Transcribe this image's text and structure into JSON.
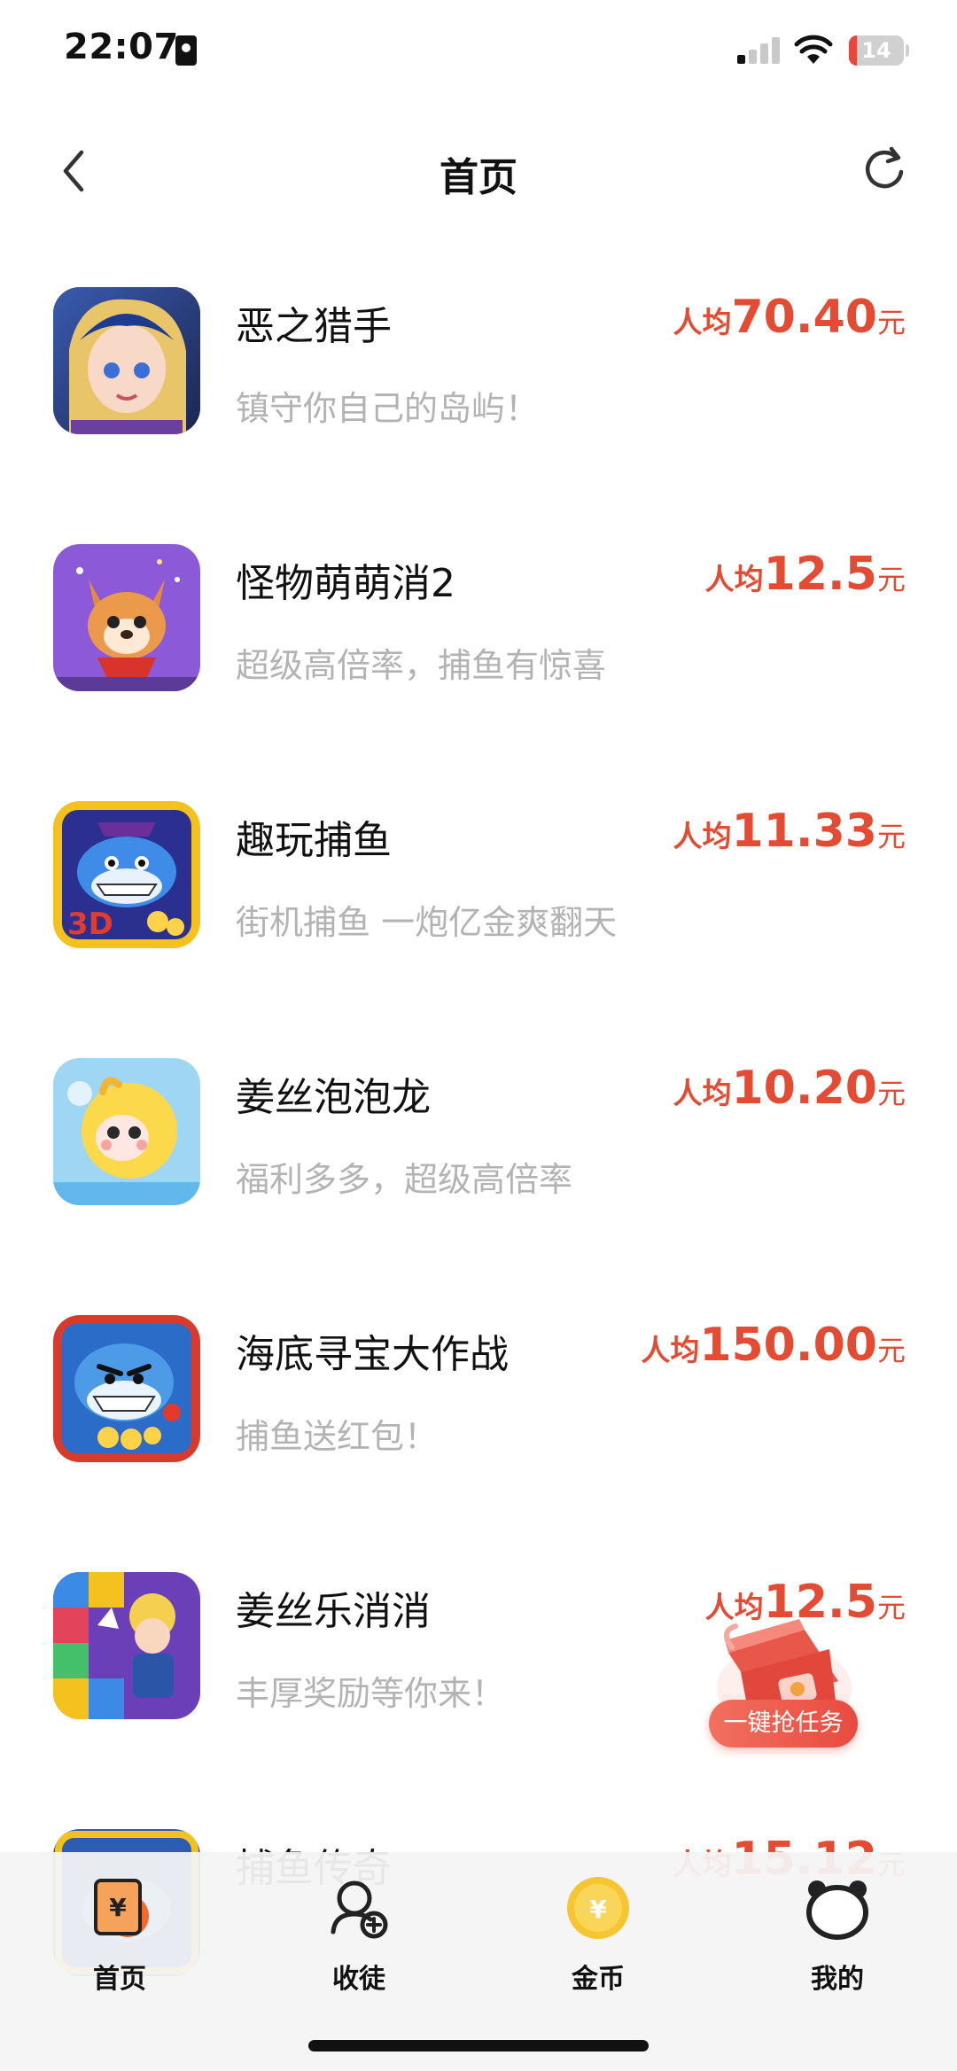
{
  "status_bar": {
    "time": "22:07",
    "battery_level": "14",
    "battery_fraction": 0.14
  },
  "nav": {
    "title": "首页"
  },
  "games": [
    {
      "name": "恶之猎手",
      "description": "镇守你自己的岛屿！",
      "reward_prefix": "人均",
      "reward_amount": "70.40",
      "reward_unit": "元",
      "icon": "hunter-game-icon"
    },
    {
      "name": "怪物萌萌消2",
      "description": "超级高倍率，捕鱼有惊喜",
      "reward_prefix": "人均",
      "reward_amount": "12.5",
      "reward_unit": "元",
      "icon": "corgi-game-icon"
    },
    {
      "name": "趣玩捕鱼",
      "description": "街机捕鱼 一炮亿金爽翻天",
      "reward_prefix": "人均",
      "reward_amount": "11.33",
      "reward_unit": "元",
      "icon": "shark-3d-game-icon"
    },
    {
      "name": "姜丝泡泡龙",
      "description": "福利多多，超级高倍率",
      "reward_prefix": "人均",
      "reward_amount": "10.20",
      "reward_unit": "元",
      "icon": "bubble-game-icon"
    },
    {
      "name": "海底寻宝大作战",
      "description": "捕鱼送红包！",
      "reward_prefix": "人均",
      "reward_amount": "150.00",
      "reward_unit": "元",
      "icon": "angry-shark-game-icon"
    },
    {
      "name": "姜丝乐消消",
      "description": "丰厚奖励等你来！",
      "reward_prefix": "人均",
      "reward_amount": "12.5",
      "reward_unit": "元",
      "icon": "puzzle-game-icon"
    },
    {
      "name": "捕鱼传奇",
      "description": "",
      "reward_prefix": "人均",
      "reward_amount": "15.12",
      "reward_unit": "元",
      "icon": "fishing-game-icon"
    }
  ],
  "task_float": {
    "label": "一键抢任务"
  },
  "tabs": [
    {
      "label": "首页",
      "icon": "home-tab-icon"
    },
    {
      "label": "收徒",
      "icon": "recruit-tab-icon"
    },
    {
      "label": "金币",
      "icon": "coin-tab-icon"
    },
    {
      "label": "我的",
      "icon": "bear-profile-tab-icon"
    }
  ],
  "colors": {
    "reward": "#e34b33",
    "description": "#b3b3b3",
    "accent_orange": "#f26a2e",
    "coin_yellow": "#f7c531"
  }
}
